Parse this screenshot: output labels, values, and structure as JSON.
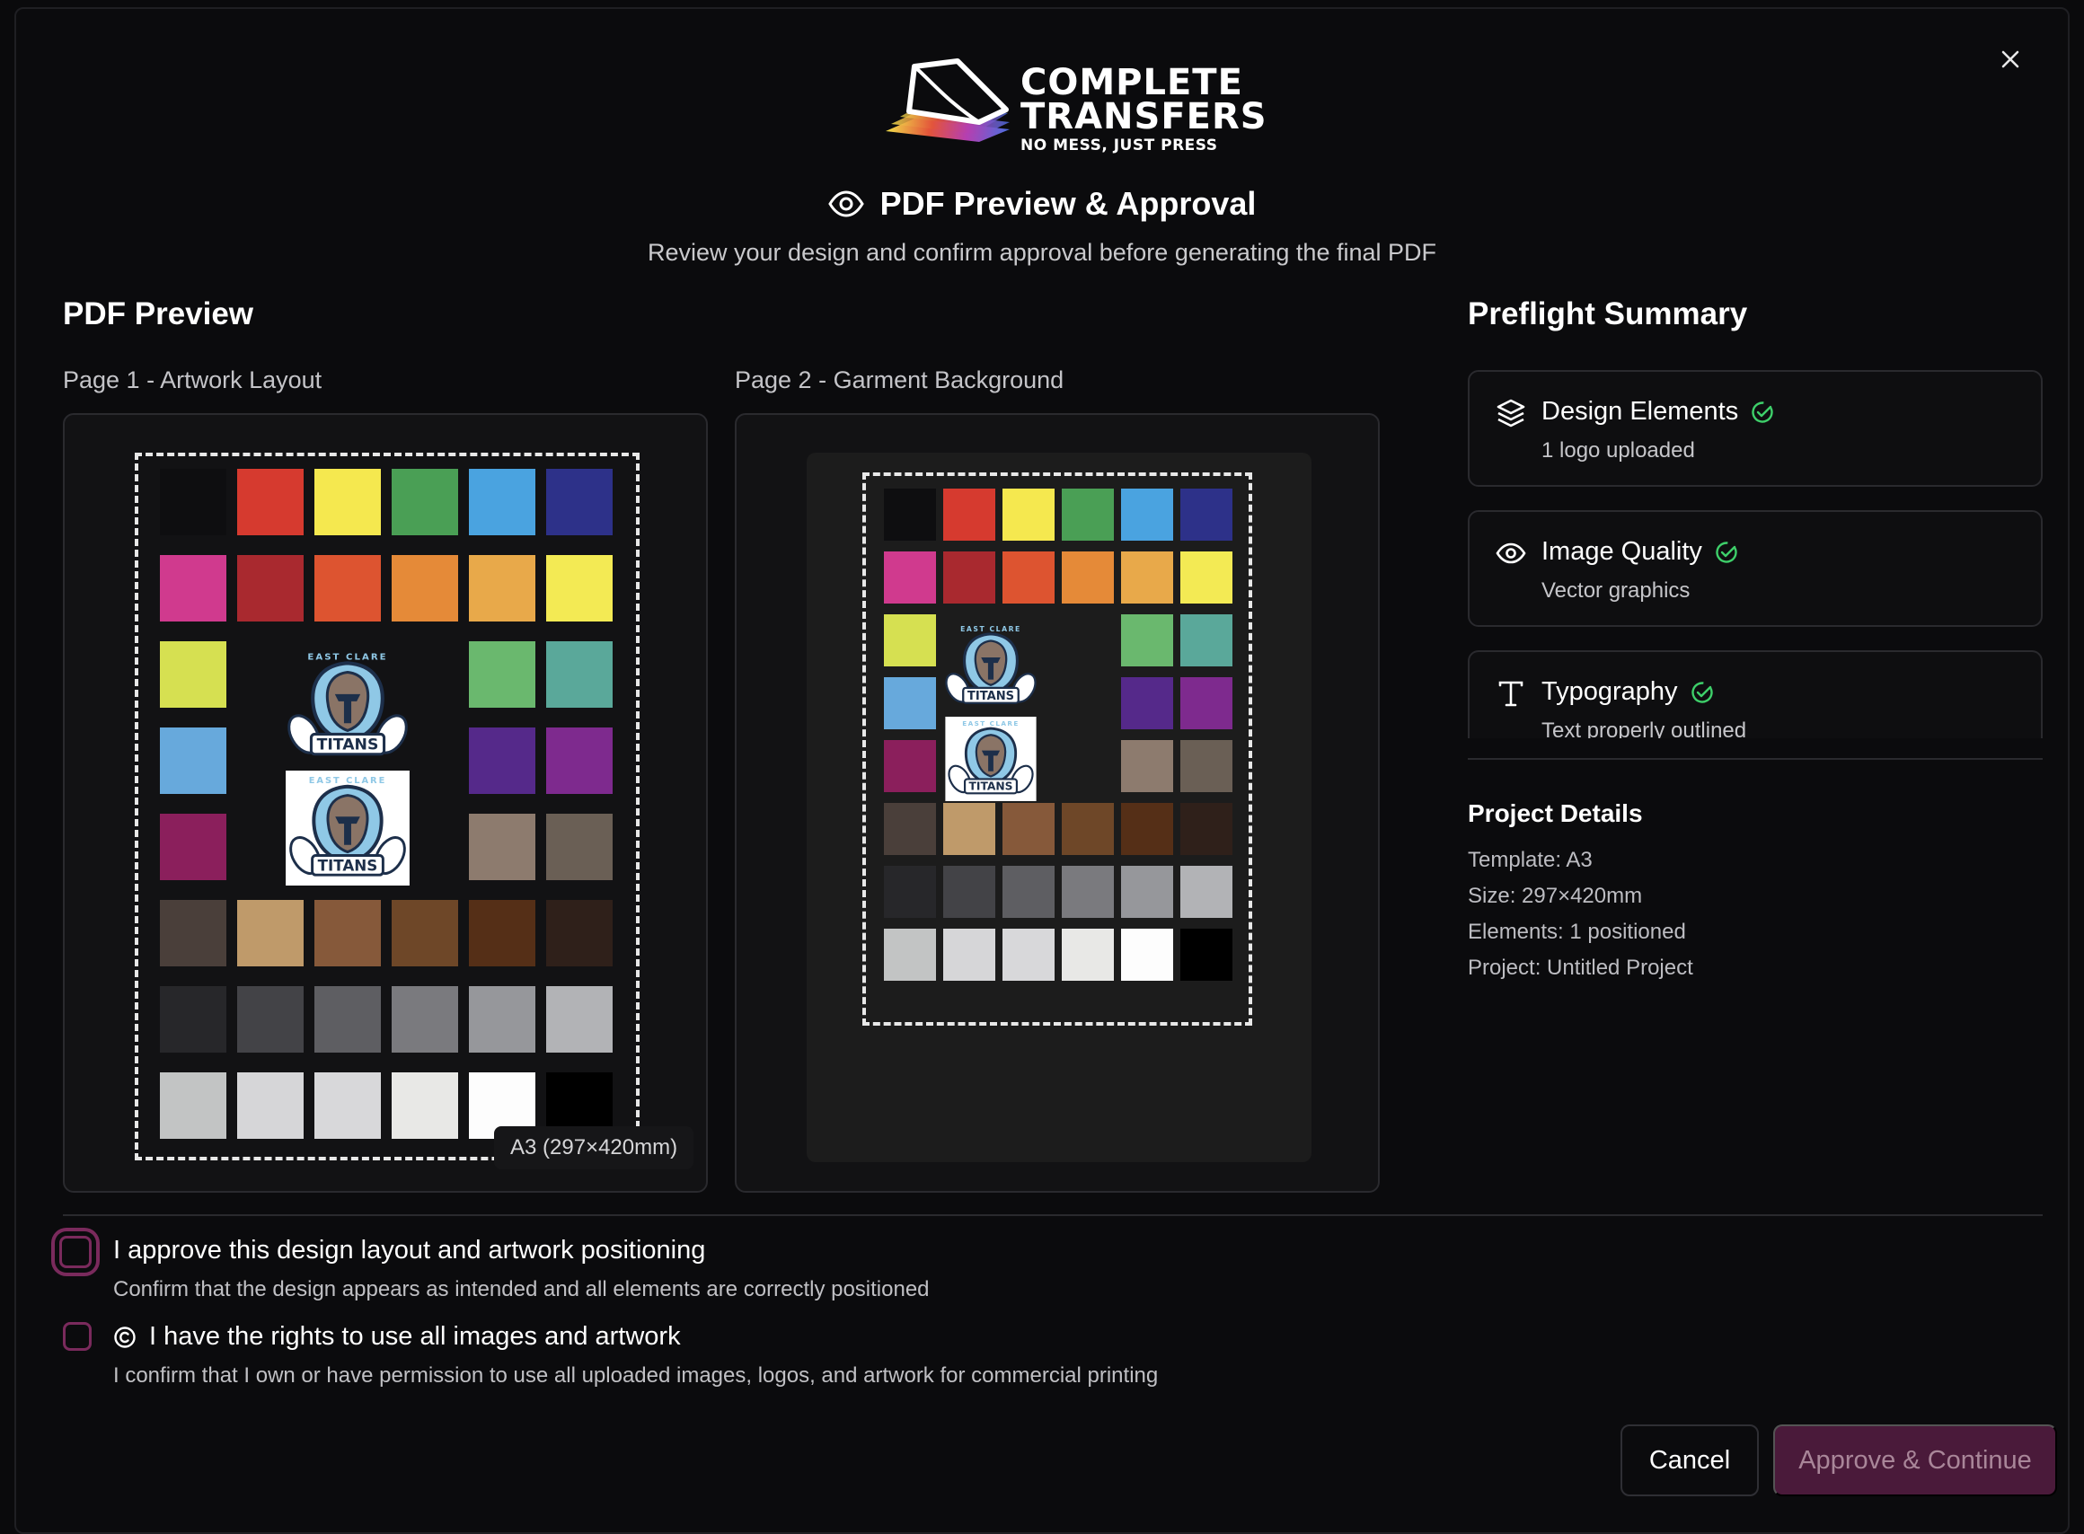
{
  "brand": {
    "line1": "COMPLETE",
    "line2": "TRANSFERS",
    "tagline": "NO MESS, JUST PRESS"
  },
  "header": {
    "title": "PDF Preview & Approval",
    "subtitle": "Review your design and confirm approval before generating the final PDF",
    "icon": "eye-icon"
  },
  "preview": {
    "heading": "PDF Preview",
    "page1_label": "Page 1 - Artwork Layout",
    "page2_label": "Page 2 - Garment Background",
    "size_badge": "A3 (297×420mm)",
    "logo_text": {
      "top": "EAST CLARE",
      "bottom": "TITANS"
    }
  },
  "preflight": {
    "heading": "Preflight Summary",
    "items": [
      {
        "title": "Design Elements",
        "sub": "1 logo uploaded",
        "icon": "layers-icon",
        "status": "check-circle-icon"
      },
      {
        "title": "Image Quality",
        "sub": "Vector graphics",
        "icon": "eye-icon",
        "status": "check-circle-icon"
      },
      {
        "title": "Typography",
        "sub": "Text properly outlined",
        "icon": "type-icon",
        "status": "check-circle-icon"
      }
    ]
  },
  "project_details": {
    "heading": "Project Details",
    "lines": [
      "Template: A3",
      "Size: 297×420mm",
      "Elements: 1 positioned",
      "Project: Untitled Project"
    ]
  },
  "approvals": [
    {
      "label": "I approve this design layout and artwork positioning",
      "sub": "Confirm that the design appears as intended and all elements are correctly positioned",
      "checked": false
    },
    {
      "label": "I have the rights to use all images and artwork",
      "sub": "I confirm that I own or have permission to use all uploaded images, logos, and artwork for commercial printing",
      "checked": false,
      "icon": "copyright-icon"
    }
  ],
  "actions": {
    "cancel": "Cancel",
    "approve": "Approve & Continue"
  },
  "colors": {
    "accent": "#7a2a5c",
    "check_green": "#3ecf6a",
    "approve_bg": "#4a1a3a",
    "swatches": [
      [
        "#0e0e10",
        "#d63a2f",
        "#f5e84f",
        "#4a9f55",
        "#4aa3e0",
        "#2d3189"
      ],
      [
        "#d03a8e",
        "#a9292f",
        "#dd5430",
        "#e58a38",
        "#e8a94a",
        "#f3ea54"
      ],
      [
        "#d6e051",
        "logo",
        "logo",
        "logo",
        "#6ab86e",
        "#5aa89a"
      ],
      [
        "#67a9dc",
        "logo",
        "logo",
        "logo",
        "#55298a",
        "#7e2a8e"
      ],
      [
        "#8b1f5c",
        "logo",
        "logo",
        "logo",
        "#8d7b6e",
        "#6a5f55"
      ],
      [
        "#4a3f3a",
        "#bf9a6a",
        "#86593a",
        "#6e4728",
        "#552f17",
        "#2f201a"
      ],
      [
        "#27272a",
        "#434347",
        "#5e5e62",
        "#7a7a7e",
        "#96979b",
        "#b2b3b6"
      ],
      [
        "#c2c4c4",
        "#d6d6d8",
        "#d8d8da",
        "#e8e8e6",
        "#fdfdfd",
        "#000000"
      ]
    ]
  }
}
